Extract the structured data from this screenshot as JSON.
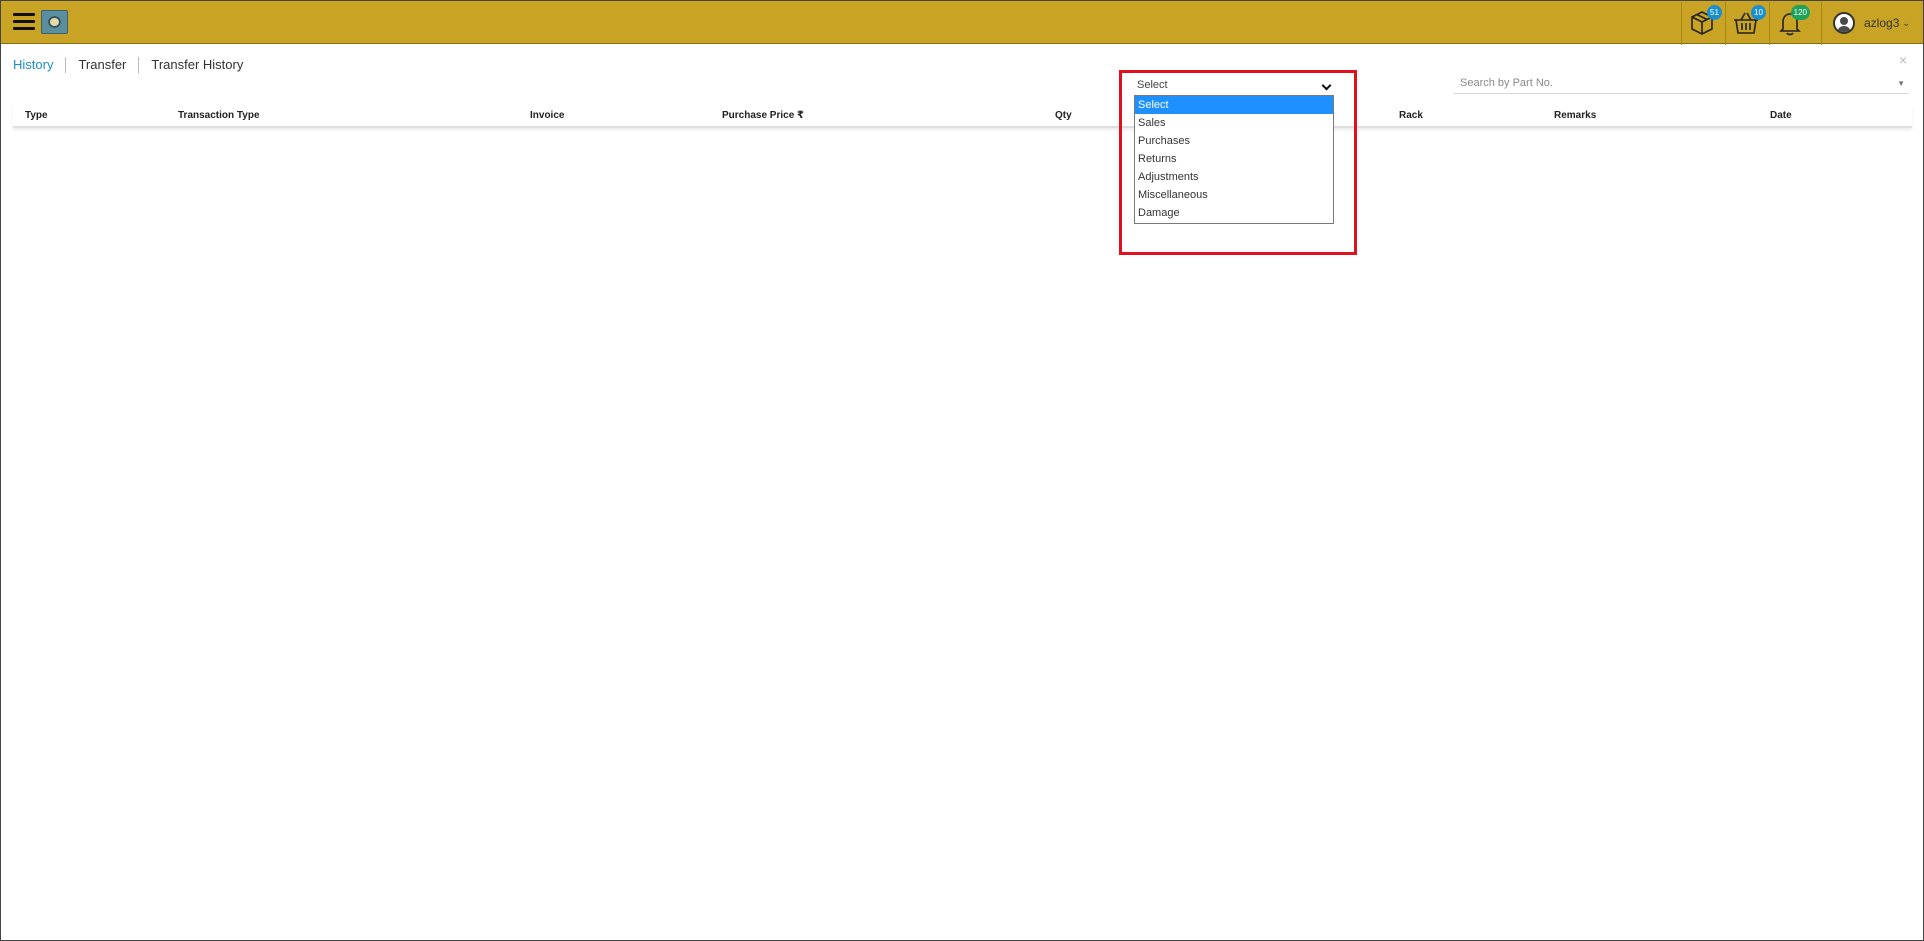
{
  "topbar": {
    "menu_icon": "hamburger-menu-icon",
    "logo_icon": "app-logo-icon",
    "icons": [
      {
        "name": "package-icon",
        "badge": "51",
        "badge_color": "#1a8fd0"
      },
      {
        "name": "basket-icon",
        "badge": "10",
        "badge_color": "#1a8fd0"
      },
      {
        "name": "bell-icon",
        "badge": "120",
        "badge_color": "#1fa35a"
      }
    ],
    "username": "azlog3",
    "user_chevron": "⌄"
  },
  "tabs": [
    {
      "label": "History",
      "active": true
    },
    {
      "label": "Transfer",
      "active": false
    },
    {
      "label": "Transfer History",
      "active": false
    }
  ],
  "close_label": "×",
  "search": {
    "placeholder": "Search by Part No."
  },
  "table": {
    "headers": [
      "Type",
      "Transaction Type",
      "Invoice",
      "Purchase Price ₹",
      "Qty",
      "Rack",
      "Remarks",
      "Date"
    ],
    "rows": []
  },
  "type_select": {
    "selected": "Select",
    "options": [
      "Select",
      "Sales",
      "Purchases",
      "Returns",
      "Adjustments",
      "Miscellaneous",
      "Damage"
    ]
  },
  "colors": {
    "topbar": "#c9a324",
    "accent": "#1a8fc2",
    "highlight": "#e0101e",
    "option_selected": "#1e90ff"
  }
}
